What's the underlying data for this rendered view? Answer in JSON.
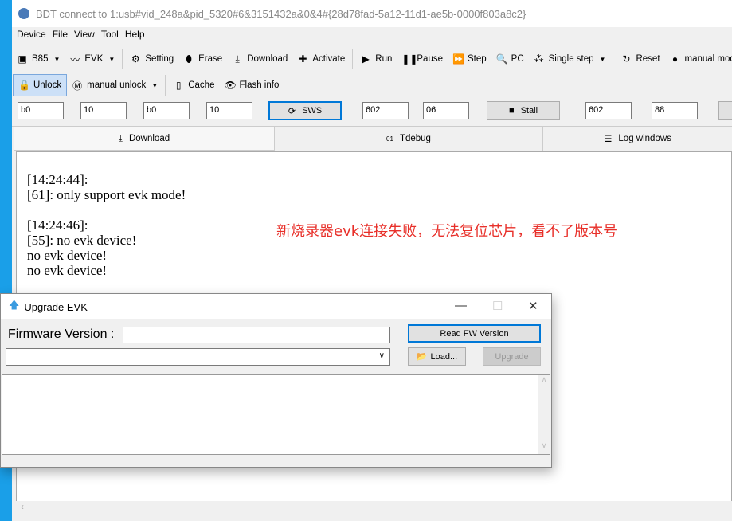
{
  "window": {
    "title": "BDT connect to 1:usb#vid_248a&pid_5320#6&3151432a&0&4#{28d78fad-5a12-11d1-ae5b-0000f803a8c2}"
  },
  "menu": [
    "Device",
    "File",
    "View",
    "Tool",
    "Help"
  ],
  "toolbar1": [
    {
      "icon": "chip-icon",
      "label": "B85",
      "dropdown": true
    },
    {
      "icon": "waveform-icon",
      "label": "EVK",
      "dropdown": true
    },
    {
      "icon": "gear-icon",
      "label": "Setting"
    },
    {
      "icon": "eraser-icon",
      "label": "Erase"
    },
    {
      "icon": "download-icon",
      "label": "Download"
    },
    {
      "icon": "plus-icon",
      "label": "Activate"
    },
    {
      "icon": "run-icon",
      "label": "Run"
    },
    {
      "icon": "pause-icon",
      "label": "Pause"
    },
    {
      "icon": "step-icon",
      "label": "Step"
    },
    {
      "icon": "search-icon",
      "label": "PC"
    },
    {
      "icon": "footsteps-icon",
      "label": "Single step",
      "dropdown": true
    },
    {
      "icon": "reset-icon",
      "label": "Reset"
    },
    {
      "icon": "manual-mode-icon",
      "label": "manual mode"
    }
  ],
  "toolbar2": [
    {
      "icon": "unlock-icon",
      "label": "Unlock"
    },
    {
      "icon": "mail-icon",
      "label": "manual unlock",
      "dropdown": true
    },
    {
      "icon": "sd-card-icon",
      "label": "Cache"
    },
    {
      "icon": "eye-icon",
      "label": "Flash info"
    }
  ],
  "fields": [
    "b0",
    "10",
    "b0",
    "10",
    "602",
    "06",
    "602",
    "88"
  ],
  "buttons": {
    "sws": "SWS",
    "stall": "Stall"
  },
  "tabs": [
    "Download",
    "Tdebug",
    "Log windows"
  ],
  "log": "[14:24:44]:\n[61]: only support evk mode!\n\n[14:24:46]:\n[55]: no evk device!\nno evk device!\nno evk device!",
  "annotation": "新烧录器evk连接失败，无法复位芯片，看不了版本号",
  "dialog": {
    "title": "Upgrade EVK",
    "fw_label": "Firmware Version :",
    "fw_value": "",
    "read_button": "Read FW Version",
    "load_button": "Load...",
    "upgrade_button": "Upgrade",
    "file_select": ""
  }
}
